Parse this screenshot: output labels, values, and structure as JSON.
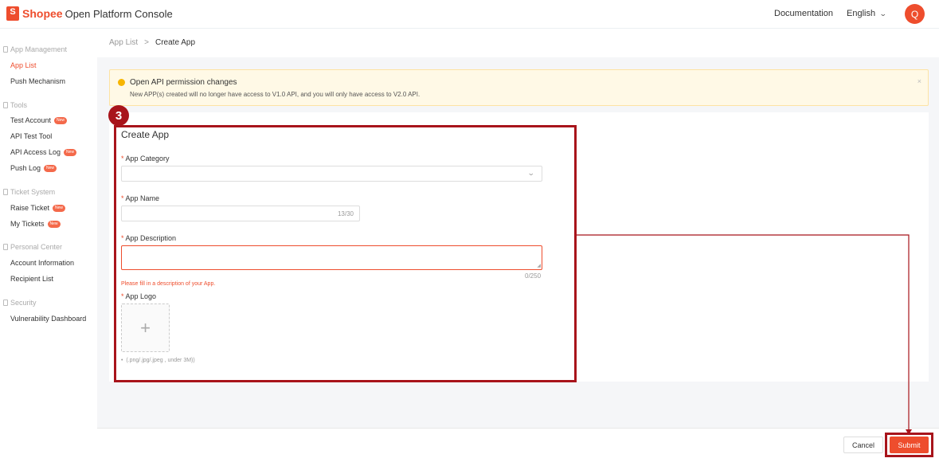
{
  "header": {
    "brand": "Shopee",
    "title": "Open Platform Console",
    "documentation": "Documentation",
    "language": "English",
    "avatar_letter": "Q"
  },
  "sidebar": {
    "groups": [
      {
        "label": "App Management",
        "items": [
          {
            "label": "App List",
            "active": true
          },
          {
            "label": "Push Mechanism"
          }
        ]
      },
      {
        "label": "Tools",
        "items": [
          {
            "label": "Test Account",
            "badge": "New"
          },
          {
            "label": "API Test Tool"
          },
          {
            "label": "API Access Log",
            "badge": "New"
          },
          {
            "label": "Push Log",
            "badge": "New"
          }
        ]
      },
      {
        "label": "Ticket System",
        "items": [
          {
            "label": "Raise Ticket",
            "badge": "New"
          },
          {
            "label": "My Tickets",
            "badge": "New"
          }
        ]
      },
      {
        "label": "Personal Center",
        "items": [
          {
            "label": "Account Information"
          },
          {
            "label": "Recipient List"
          }
        ]
      },
      {
        "label": "Security",
        "items": [
          {
            "label": "Vulnerability Dashboard"
          }
        ]
      }
    ]
  },
  "breadcrumb": {
    "parent": "App List",
    "separator": ">",
    "current": "Create App"
  },
  "alert": {
    "title": "Open API permission changes",
    "text": "New APP(s) created will no longer have access to V1.0 API, and you will only have access to V2.0 API.",
    "close": "×"
  },
  "form": {
    "title": "Create App",
    "required_mark": "*",
    "category_label": "App Category",
    "category_value": "",
    "name_label": "App Name",
    "name_value": "",
    "name_count": "13/30",
    "description_label": "App Description",
    "description_value": "",
    "description_count": "0/250",
    "description_error": "Please fill in a description of your App.",
    "logo_label": "App Logo",
    "upload_plus": "+",
    "logo_hint": "(.png/.jpg/.jpeg , under 3M))"
  },
  "annotation": {
    "step_number": "3",
    "color": "#a8141b"
  },
  "footer": {
    "cancel_label": "Cancel",
    "submit_label": "Submit"
  },
  "colors": {
    "brand": "#ee4d2d",
    "alert_bg": "#fff9e6",
    "alert_icon": "#f7b500"
  }
}
